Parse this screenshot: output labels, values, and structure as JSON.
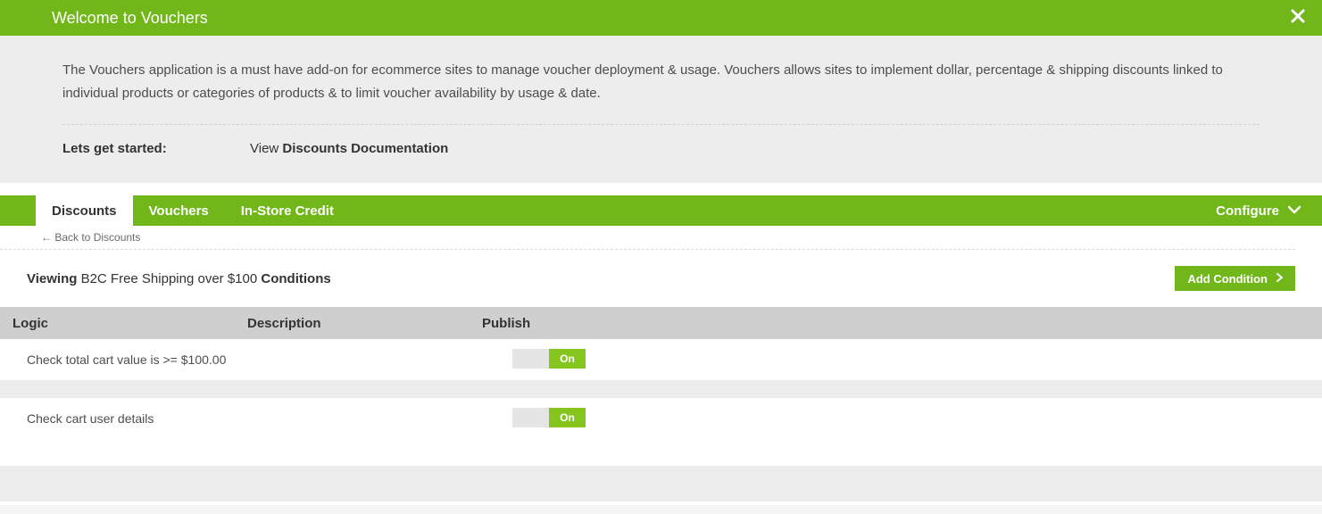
{
  "welcome": {
    "title": "Welcome to Vouchers",
    "intro": "The Vouchers application is a must have add-on for ecommerce sites to manage voucher deployment & usage. Vouchers allows sites to implement dollar, percentage & shipping discounts linked to individual products or categories of products & to limit voucher availability  by usage & date.",
    "lets_get_started": "Lets get started:",
    "view_text": "View ",
    "doc_link": "Discounts Documentation"
  },
  "tabs": {
    "discounts": "Discounts",
    "vouchers": "Vouchers",
    "instore": "In-Store Credit",
    "configure": "Configure"
  },
  "back_link": "← Back to Discounts",
  "viewing": {
    "prefix": "Viewing",
    "name": " B2C Free Shipping over $100 ",
    "suffix": "Conditions",
    "add_condition": "Add Condition"
  },
  "table": {
    "headers": {
      "logic": "Logic",
      "description": "Description",
      "publish": "Publish"
    },
    "rows": [
      {
        "logic": "Check total cart value is >= $100.00",
        "description": "",
        "publish": "On"
      },
      {
        "logic": "Check cart user details",
        "description": "",
        "publish": "On"
      }
    ]
  }
}
